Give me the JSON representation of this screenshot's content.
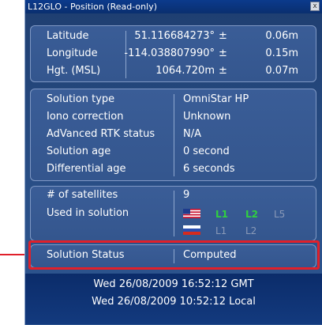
{
  "window": {
    "title": "L12GLO - Position (Read-only)",
    "close_glyph": "x"
  },
  "position": {
    "latitude": {
      "label": "Latitude",
      "value": "51.116684273°",
      "pm": "±",
      "err": "0.06m"
    },
    "longitude": {
      "label": "Longitude",
      "value": "-114.038807990°",
      "pm": "±",
      "err": "0.15m"
    },
    "height": {
      "label": "Hgt. (MSL)",
      "value": "1064.720m",
      "pm": "±",
      "err": "0.07m"
    }
  },
  "solution": {
    "type": {
      "label": "Solution type",
      "value": "OmniStar HP"
    },
    "iono": {
      "label": "Iono correction",
      "value": "Unknown"
    },
    "rtk": {
      "label": "AdVanced RTK status",
      "value": "N/A"
    },
    "age": {
      "label": "Solution age",
      "value": "0 second"
    },
    "diff_age": {
      "label": "Differential age",
      "value": "6 seconds"
    }
  },
  "satellites": {
    "count_label": "# of satellites",
    "count": "9",
    "used_label": "Used in solution",
    "gps": {
      "flag": "usa-flag-icon",
      "l1": "L1",
      "l2": "L2",
      "l5": "L5"
    },
    "glonass": {
      "flag": "russia-flag-icon",
      "l1": "L1",
      "l2": "L2"
    },
    "colors": {
      "active": "#30d040",
      "inactive": "#8a9ab8"
    }
  },
  "status": {
    "label": "Solution Status",
    "value": "Computed",
    "highlight_color": "#e0202a"
  },
  "time": {
    "gmt": "Wed 26/08/2009 16:52:12 GMT",
    "local": "Wed 26/08/2009 10:52:12 Local"
  }
}
